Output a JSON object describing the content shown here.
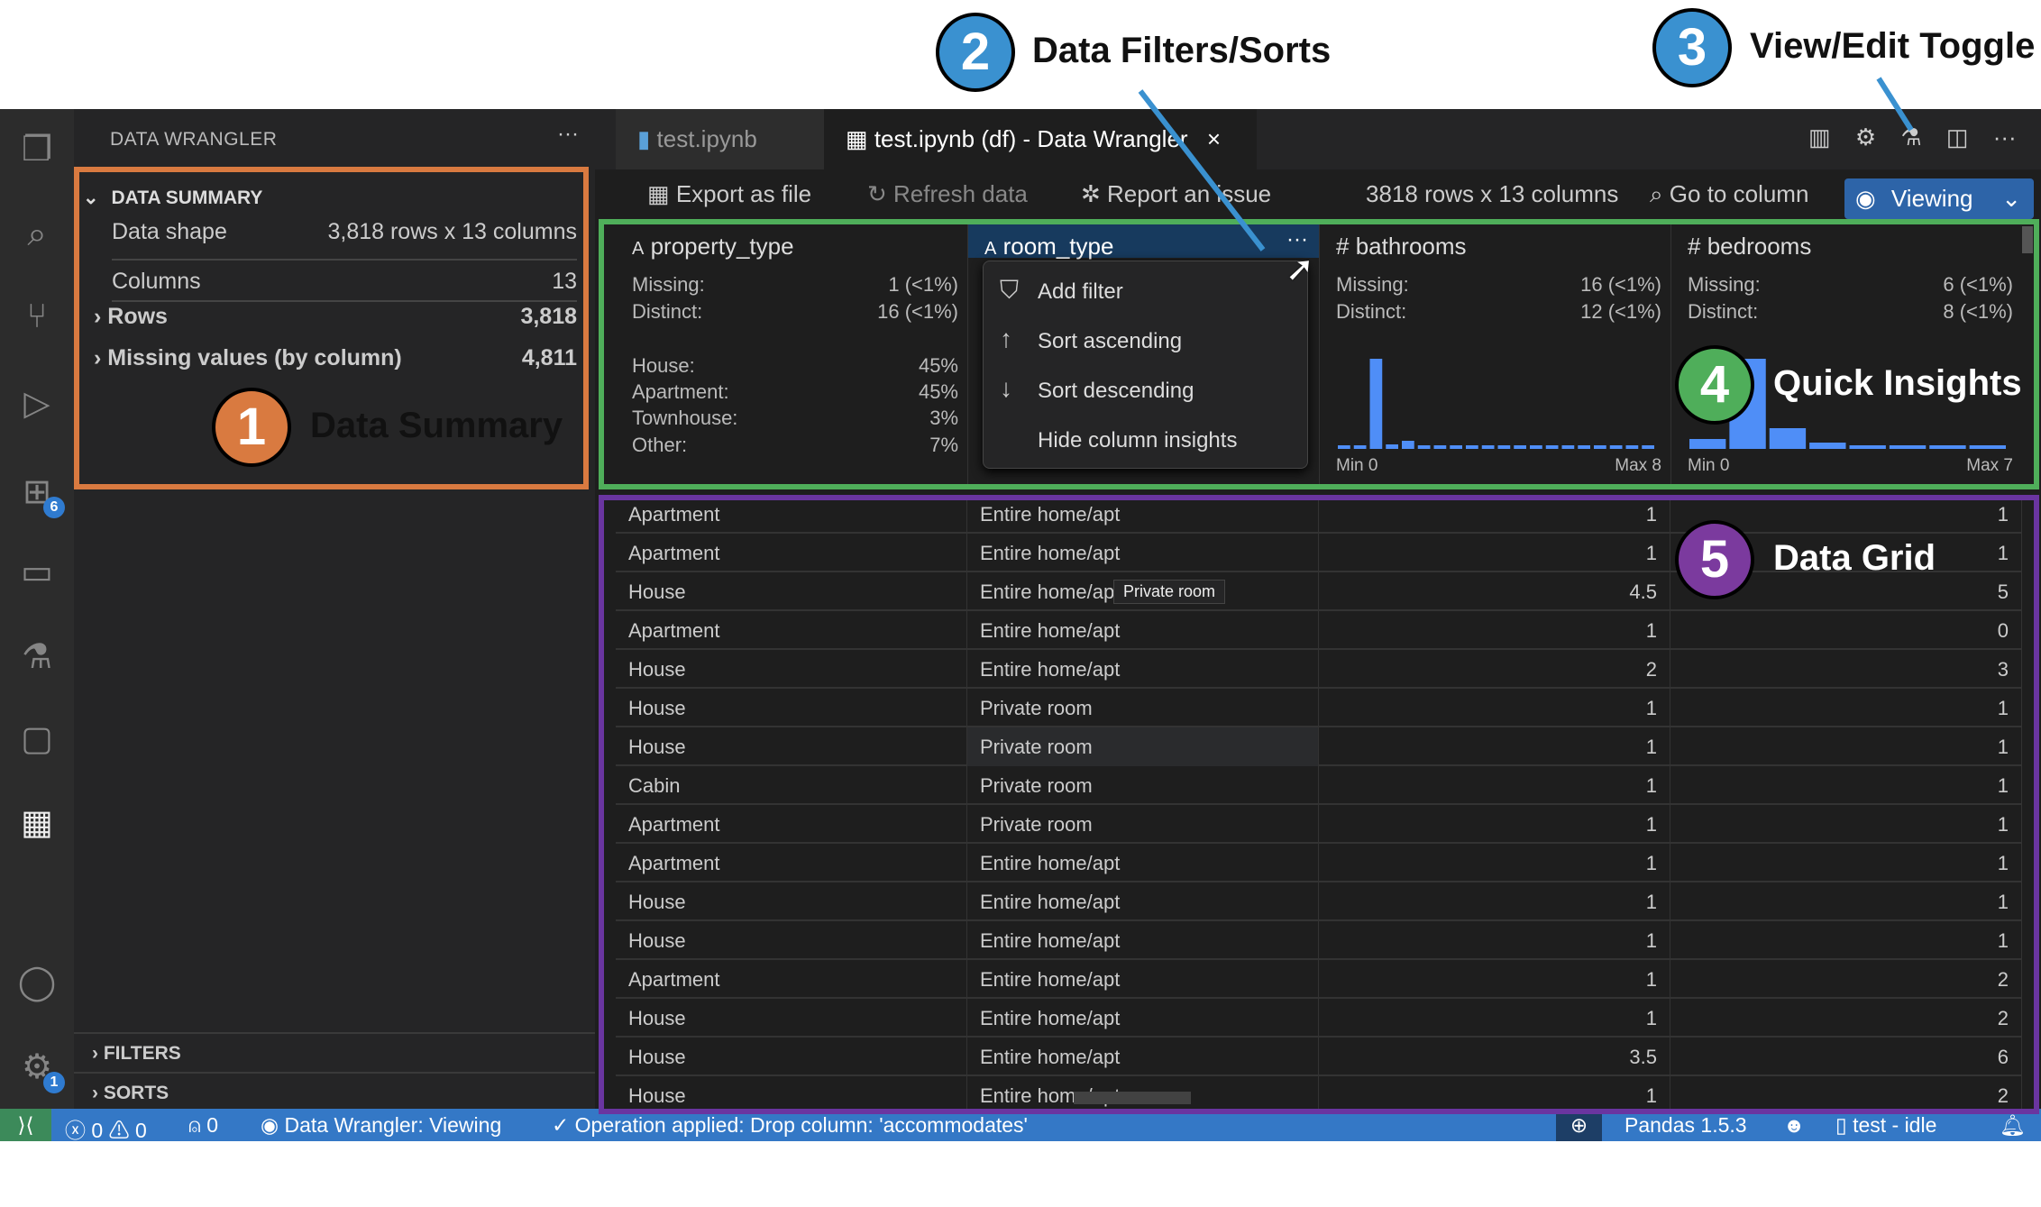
{
  "sidebar": {
    "title": "DATA WRANGLER",
    "more": "···",
    "section": "DATA SUMMARY",
    "data_shape_label": "Data shape",
    "data_shape_value": "3,818 rows x 13 columns",
    "columns_label": "Columns",
    "columns_value": "13",
    "rows_label": "Rows",
    "rows_value": "3,818",
    "missing_label": "Missing values (by column)",
    "missing_value": "4,811",
    "filters": "FILTERS",
    "sorts": "SORTS"
  },
  "activity": {
    "extensions_badge": "6",
    "settings_badge": "1"
  },
  "tabs": [
    {
      "label": "test.ipynb"
    },
    {
      "label": "test.ipynb (df) - Data Wrangler",
      "close": "×"
    }
  ],
  "toolbar": {
    "export": "Export as file",
    "refresh": "Refresh data",
    "report": "Report an issue",
    "shape": "3818 rows x 13 columns",
    "goto": "Go to column",
    "mode": "Viewing"
  },
  "columns": [
    {
      "name": "property_type",
      "type_icon": "A",
      "missing_label": "Missing:",
      "missing": "1 (<1%)",
      "distinct_label": "Distinct:",
      "distinct": "16 (<1%)",
      "categories": [
        {
          "label": "House:",
          "value": "45%"
        },
        {
          "label": "Apartment:",
          "value": "45%"
        },
        {
          "label": "Townhouse:",
          "value": "3%"
        },
        {
          "label": "Other:",
          "value": "7%"
        }
      ]
    },
    {
      "name": "room_type",
      "type_icon": "A",
      "more": "···"
    },
    {
      "name": "bathrooms",
      "type_icon": "#",
      "missing_label": "Missing:",
      "missing": "16 (<1%)",
      "distinct_label": "Distinct:",
      "distinct": "12 (<1%)",
      "min": "Min 0",
      "max": "Max 8",
      "histogram": [
        0.03,
        0.03,
        1.0,
        0.05,
        0.09,
        0.03,
        0.03,
        0.03,
        0.03,
        0.03,
        0.03,
        0.03,
        0.03,
        0.03,
        0.03,
        0.03,
        0.03,
        0.03,
        0.03,
        0.03
      ]
    },
    {
      "name": "bedrooms",
      "type_icon": "#",
      "missing_label": "Missing:",
      "missing": "6 (<1%)",
      "distinct_label": "Distinct:",
      "distinct": "8 (<1%)",
      "min": "Min 0",
      "max": "Max 7",
      "histogram": [
        0.11,
        1.0,
        0.23,
        0.07,
        0.03,
        0.03,
        0.03,
        0.03
      ]
    }
  ],
  "hist_color": "#4f8ef7",
  "menu": [
    "Add filter",
    "Sort ascending",
    "Sort descending",
    "Hide column insights"
  ],
  "tooltip": "Private room",
  "rows": [
    [
      "Apartment",
      "Entire home/apt",
      "1",
      "1"
    ],
    [
      "Apartment",
      "Entire home/apt",
      "1",
      "1"
    ],
    [
      "House",
      "Entire home/apt",
      "4.5",
      "5"
    ],
    [
      "Apartment",
      "Entire home/apt",
      "1",
      "0"
    ],
    [
      "House",
      "Entire home/apt",
      "2",
      "3"
    ],
    [
      "House",
      "Private room",
      "1",
      "1"
    ],
    [
      "House",
      "Private room",
      "1",
      "1"
    ],
    [
      "Cabin",
      "Private room",
      "1",
      "1"
    ],
    [
      "Apartment",
      "Private room",
      "1",
      "1"
    ],
    [
      "Apartment",
      "Entire home/apt",
      "1",
      "1"
    ],
    [
      "House",
      "Entire home/apt",
      "1",
      "1"
    ],
    [
      "House",
      "Entire home/apt",
      "1",
      "1"
    ],
    [
      "Apartment",
      "Entire home/apt",
      "1",
      "2"
    ],
    [
      "House",
      "Entire home/apt",
      "1",
      "2"
    ],
    [
      "House",
      "Entire home/apt",
      "3.5",
      "6"
    ],
    [
      "House",
      "Entire home/apt",
      "1",
      "2"
    ]
  ],
  "status": {
    "errors": "0",
    "warnings": "0",
    "ports": "0",
    "mode": "Data Wrangler: Viewing",
    "operation": "Operation applied: Drop column: 'accommodates'",
    "pandas": "Pandas 1.5.3",
    "kernel": "test - idle"
  },
  "annotations": [
    {
      "num": "1",
      "label": "Data Summary",
      "color": "#d97a40"
    },
    {
      "num": "2",
      "label": "Data Filters/Sorts",
      "color": "#3a91d0"
    },
    {
      "num": "3",
      "label": "View/Edit Toggle",
      "color": "#3a91d0"
    },
    {
      "num": "4",
      "label": "Quick Insights",
      "color": "#4fae5a"
    },
    {
      "num": "5",
      "label": "Data Grid",
      "color": "#7b3a9e"
    }
  ]
}
